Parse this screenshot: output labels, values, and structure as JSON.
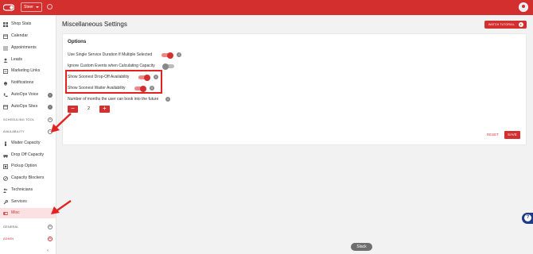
{
  "topbar": {
    "shop_select_value": "Steer",
    "colors": {
      "brand": "#d32f2f"
    }
  },
  "sidebar": {
    "items_main": [
      {
        "label": "Shop Stats",
        "icon": "grid-icon"
      },
      {
        "label": "Calendar",
        "icon": "calendar-icon"
      },
      {
        "label": "Appointments",
        "icon": "list-icon"
      },
      {
        "label": "Leads",
        "icon": "leads-icon"
      },
      {
        "label": "Marketing Links",
        "icon": "link-icon"
      },
      {
        "label": "Notifications",
        "icon": "bell-icon"
      },
      {
        "label": "AutoOps Voice",
        "icon": "phone-icon",
        "info": "i"
      },
      {
        "label": "AutoOps Sites",
        "icon": "site-icon",
        "info": "i"
      }
    ],
    "section_scheduling": "SCHEDULING TOOL",
    "section_availability": "AVAILABILITY",
    "items_availability": [
      {
        "label": "Waiter Capacity",
        "icon": "person-icon"
      },
      {
        "label": "Drop Off Capacity",
        "icon": "car-icon"
      },
      {
        "label": "Pickup Option",
        "icon": "pickup-icon"
      },
      {
        "label": "Capacity Blockers",
        "icon": "block-icon"
      },
      {
        "label": "Technicians",
        "icon": "technician-icon"
      },
      {
        "label": "Services",
        "icon": "wrench-icon"
      },
      {
        "label": "Misc",
        "icon": "toggle-icon",
        "active": true
      }
    ],
    "section_general": "GENERAL",
    "section_admin": "ADMIN",
    "collapse_glyph": "‹"
  },
  "main": {
    "title": "Miscellaneous Settings",
    "tutorial_button": "WATCH TUTORIAL",
    "card_title": "Options",
    "options": [
      {
        "label": "Use Single Service Duration If Multiple Selected",
        "enabled": true
      },
      {
        "label": "Ignore Custom Events when Calculating Capacity",
        "enabled": false
      },
      {
        "label": "Show Soonest Drop-Off Availability",
        "enabled": true
      },
      {
        "label": "Show Soonest Waiter Availability",
        "enabled": true
      }
    ],
    "months_label": "Number of months the user can book into the future",
    "months_value": "2",
    "minus_glyph": "−",
    "plus_glyph": "+",
    "info_glyph": "i",
    "reset_button": "RESET",
    "save_button": "SAVE"
  },
  "overlay": {
    "slack_label": "Slack",
    "annotation_color": "#e32222"
  }
}
